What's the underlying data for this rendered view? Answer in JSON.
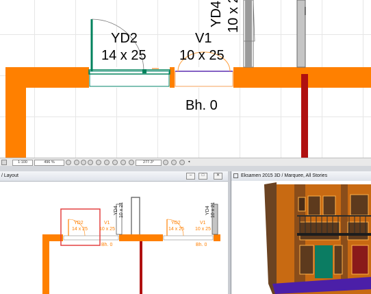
{
  "top_plan": {
    "door_yd2": {
      "name": "YD2",
      "size": "14 x 25"
    },
    "window_v1": {
      "name": "V1",
      "size": "10 x 25"
    },
    "window_yd4_rotated": {
      "name": "YD4",
      "size": "10 x 2"
    },
    "sill_height": "Bh. 0"
  },
  "status_bar": {
    "scale": "1:100",
    "zoom": "496 %",
    "angle": "277.3°"
  },
  "left_window": {
    "title": "/ Layout",
    "minimize": "–",
    "restore": "□",
    "close": "✕",
    "labels": {
      "yd2_name": "YD2",
      "yd2_size": "14 x 25",
      "v1_name": "V1",
      "v1_size": "10 x 25",
      "bh1": "Bh. 0",
      "yd2b_name": "YD2",
      "yd2b_size": "14 x 25",
      "v1b_name": "V1",
      "v1b_size": "10 x 25",
      "bh2": "Bh. 0",
      "yd4a": "YD4",
      "yd4a_size": "10 x 21",
      "yd4b": "YD4",
      "yd4b_size": "10 x 21"
    }
  },
  "right_window": {
    "title": "Eksamen 2015 3D / Marquee, All Stories"
  },
  "colors": {
    "wall": "#ff8000",
    "door_frame": "#007a55",
    "column": "#b01010",
    "selection": "#e34040"
  }
}
